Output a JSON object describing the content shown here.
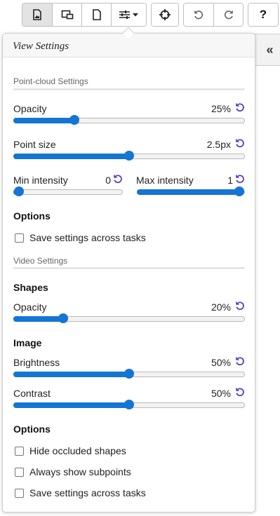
{
  "toolbar": {
    "buttons": [
      {
        "icon": "image-file-icon",
        "active": true
      },
      {
        "icon": "layout-icon",
        "active": false
      },
      {
        "icon": "blank-file-icon",
        "active": false
      },
      {
        "icon": "settings-sliders-icon",
        "active": false
      }
    ],
    "crosshair": {
      "icon": "crosshair-icon"
    },
    "undo": {
      "icon": "undo-icon"
    },
    "redo": {
      "icon": "redo-icon"
    },
    "help_label": "?"
  },
  "side_tab": {
    "label": "«"
  },
  "panel": {
    "title": "View Settings",
    "point_cloud": {
      "section_label": "Point-cloud Settings",
      "opacity": {
        "label": "Opacity",
        "value": "25%",
        "level": 0.25
      },
      "point_size": {
        "label": "Point size",
        "value": "2.5px",
        "level": 0.5
      },
      "min_intensity": {
        "label": "Min intensity",
        "value": "0",
        "level": 0.0
      },
      "max_intensity": {
        "label": "Max intensity",
        "value": "1",
        "level": 1.0
      },
      "options_heading": "Options",
      "save_settings": {
        "label": "Save settings across tasks",
        "checked": false
      }
    },
    "video": {
      "section_label": "Video Settings",
      "shapes_heading": "Shapes",
      "opacity": {
        "label": "Opacity",
        "value": "20%",
        "level": 0.2
      },
      "image_heading": "Image",
      "brightness": {
        "label": "Brightness",
        "value": "50%",
        "level": 0.5
      },
      "contrast": {
        "label": "Contrast",
        "value": "50%",
        "level": 0.5
      },
      "options_heading": "Options",
      "hide_occluded": {
        "label": "Hide occluded shapes",
        "checked": false
      },
      "always_subpoints": {
        "label": "Always show subpoints",
        "checked": false
      },
      "save_settings": {
        "label": "Save settings across tasks",
        "checked": false
      }
    }
  },
  "colors": {
    "accent": "#1475d4",
    "reset_icon": "#5b3fc4"
  }
}
